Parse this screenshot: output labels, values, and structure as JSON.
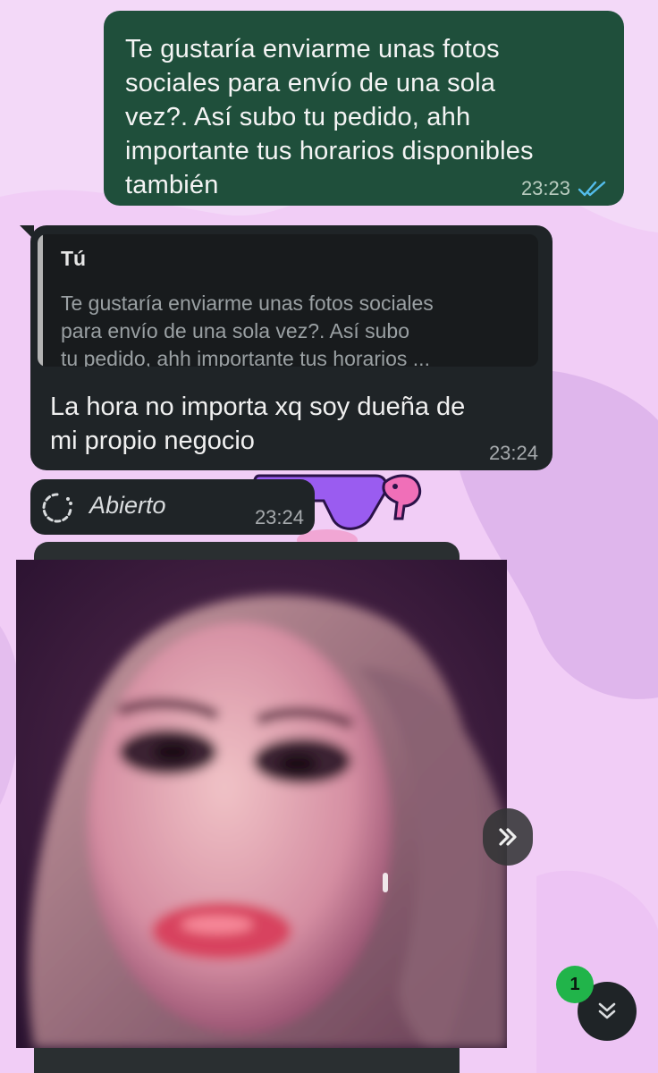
{
  "chat": {
    "sent_message": {
      "text": "Te gustaría enviarme unas fotos\nsociales para envío  de una sola\nvez?. Así subo tu pedido, ahh\nimportante  tus horarios disponibles\ntambién",
      "time": "23:23",
      "status_icon": "double-check-read-icon"
    },
    "reply_message": {
      "quoted_author": "Tú",
      "quoted_text": "Te gustaría enviarme unas fotos sociales\npara envío  de una sola vez?. Así subo\ntu pedido, ahh importante  tus horarios ...",
      "text": "La hora no importa xq soy dueña de\nmi propio negocio",
      "time": "23:24"
    },
    "view_once_message": {
      "icon": "view-once-icon",
      "label": "Abierto",
      "time": "23:24"
    },
    "photo_message": {
      "image": "blurred-selfie-photo"
    }
  },
  "controls": {
    "forward_icon": "forward-icon",
    "scroll_down_icon": "double-chevron-down-icon",
    "unread_count": "1"
  },
  "colors": {
    "wallpaper": "#f1cdf6",
    "sent_bubble": "#1f4f3b",
    "received_bubble": "#1f2427",
    "read_ticks": "#53bdeb",
    "unread_badge": "#21b44a"
  }
}
